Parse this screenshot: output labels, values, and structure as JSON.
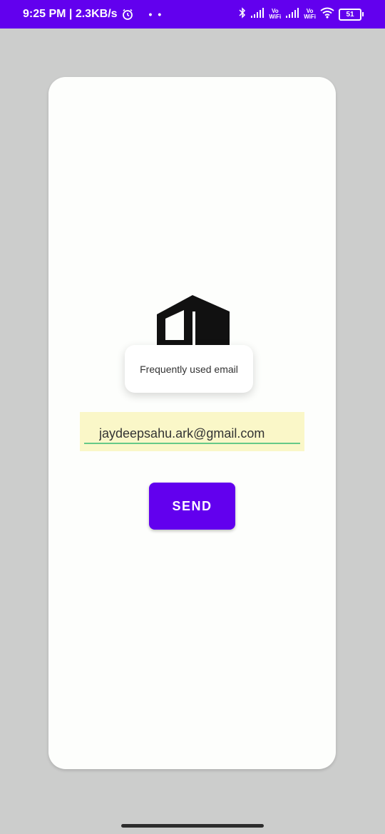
{
  "status_bar": {
    "time_speed": "9:25 PM | 2.3KB/s",
    "dots": "• •",
    "vo_wifi_1_top": "Vo",
    "vo_wifi_1_bottom": "WiFi",
    "vo_wifi_2_top": "Vo",
    "vo_wifi_2_bottom": "WiFi",
    "battery_level": "51",
    "colors": {
      "background": "#6200ee",
      "foreground": "#ffffff"
    },
    "icons": [
      "alarm-icon",
      "bluetooth-icon",
      "signal-icon",
      "signal-icon",
      "wifi-icon",
      "battery-icon"
    ]
  },
  "tooltip": {
    "text": "Frequently used email"
  },
  "email_field": {
    "value": "jaydeepsahu.ark@gmail.com"
  },
  "send_button": {
    "label": "SEND",
    "color": "#6200ee"
  },
  "logo": {
    "icon": "house-logo-icon"
  }
}
